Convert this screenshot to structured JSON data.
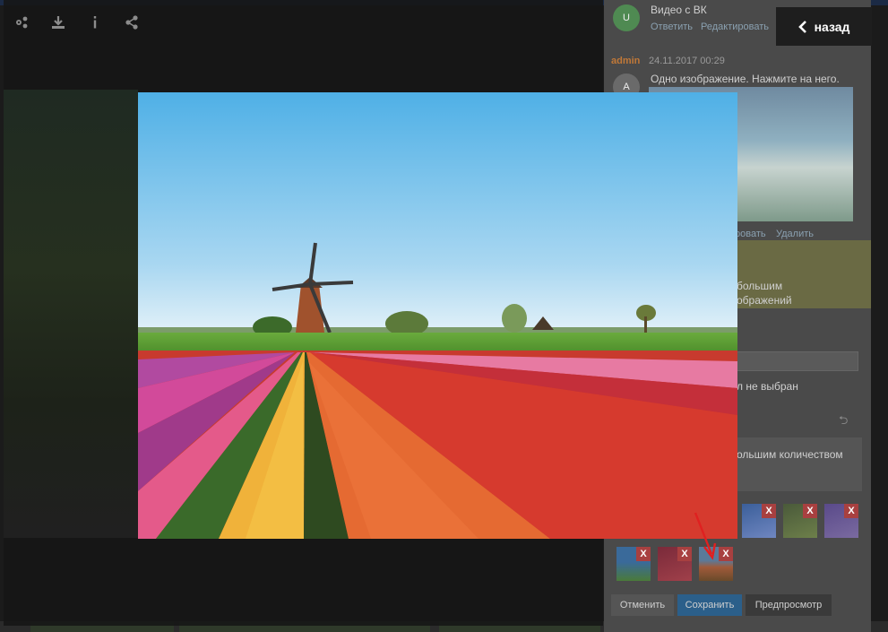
{
  "lightbox": {
    "back_label": "назад",
    "toolbar_icons": [
      "settings-icon",
      "download-icon",
      "info-icon",
      "share-icon"
    ],
    "image_subject": "tulip-field-with-windmill"
  },
  "comments_panel": {
    "comment_1": {
      "avatar_letter": "U",
      "text": "Видео с ВК",
      "actions": [
        "Ответить",
        "Редактировать"
      ]
    },
    "comment_2": {
      "author": "admin",
      "date": "24.11.2017 00:29",
      "avatar_letter": "A",
      "text": "Одно изображение. Нажмите на него.",
      "actions": [
        "ровать",
        "Удалить"
      ]
    },
    "notice_line_1": "большим",
    "notice_line_2": "ображений",
    "file_status": "л не выбран",
    "textarea_text": "ольшим количеством",
    "buttons": {
      "cancel": "Отменить",
      "save": "Сохранить",
      "preview": "Предпросмотр"
    },
    "thumb_remove_label": "X"
  },
  "colors": {
    "back_button_bg": "#1e1e1e",
    "save_button": "#2b5f8a",
    "remove_badge": "#a84040",
    "annotation_arrow": "#e02020"
  }
}
